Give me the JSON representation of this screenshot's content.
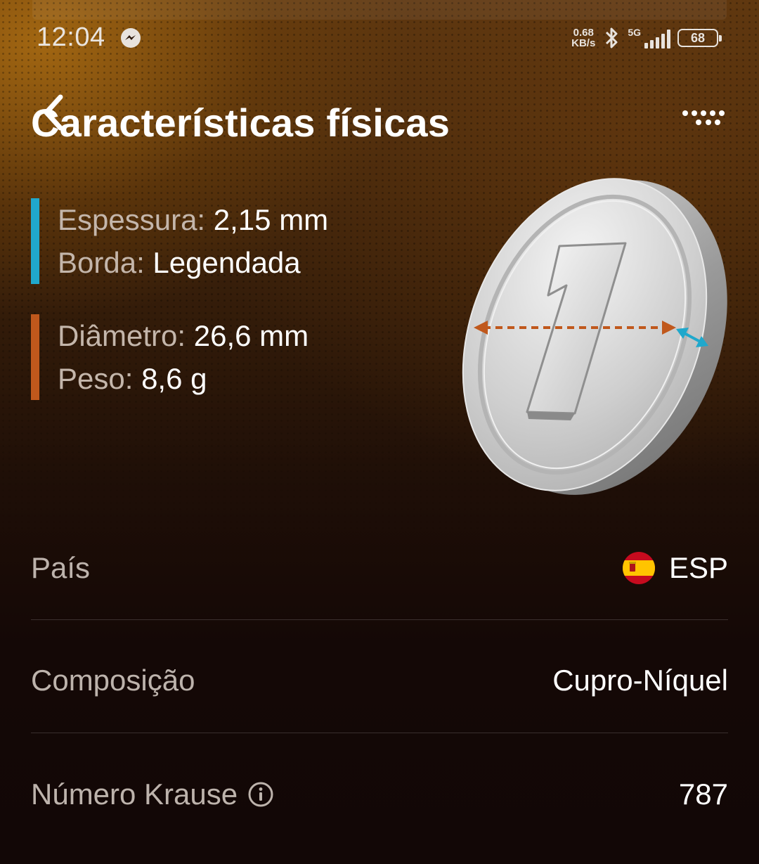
{
  "status_bar": {
    "time": "12:04",
    "net_speed_value": "0.68",
    "net_speed_unit": "KB/s",
    "network_type": "5G",
    "battery": "68",
    "icons": [
      "messenger-icon",
      "bluetooth-icon",
      "signal-icon",
      "battery-icon"
    ]
  },
  "header": {
    "title": "Características físicas",
    "back_icon": "back-chevron-icon",
    "menu_icon": "more-dots-icon"
  },
  "specs": {
    "group1": {
      "accent_color": "#20a8cc",
      "thickness_label": "Espessura:",
      "thickness_value": "2,15 mm",
      "edge_label": "Borda:",
      "edge_value": "Legendada"
    },
    "group2": {
      "accent_color": "#c0581c",
      "diameter_label": "Diâmetro:",
      "diameter_value": "26,6 mm",
      "weight_label": "Peso:",
      "weight_value": "8,6 g"
    }
  },
  "coin": {
    "face_numeral": "1",
    "diameter_arrow_color": "#c0581c",
    "thickness_arrow_color": "#20a8cc"
  },
  "details": {
    "rows": [
      {
        "label": "País",
        "value": "ESP",
        "icon": "spain-flag-icon"
      },
      {
        "label": "Composição",
        "value": "Cupro-Níquel"
      },
      {
        "label": "Número Krause",
        "value": "787",
        "icon": "info-icon"
      }
    ]
  }
}
